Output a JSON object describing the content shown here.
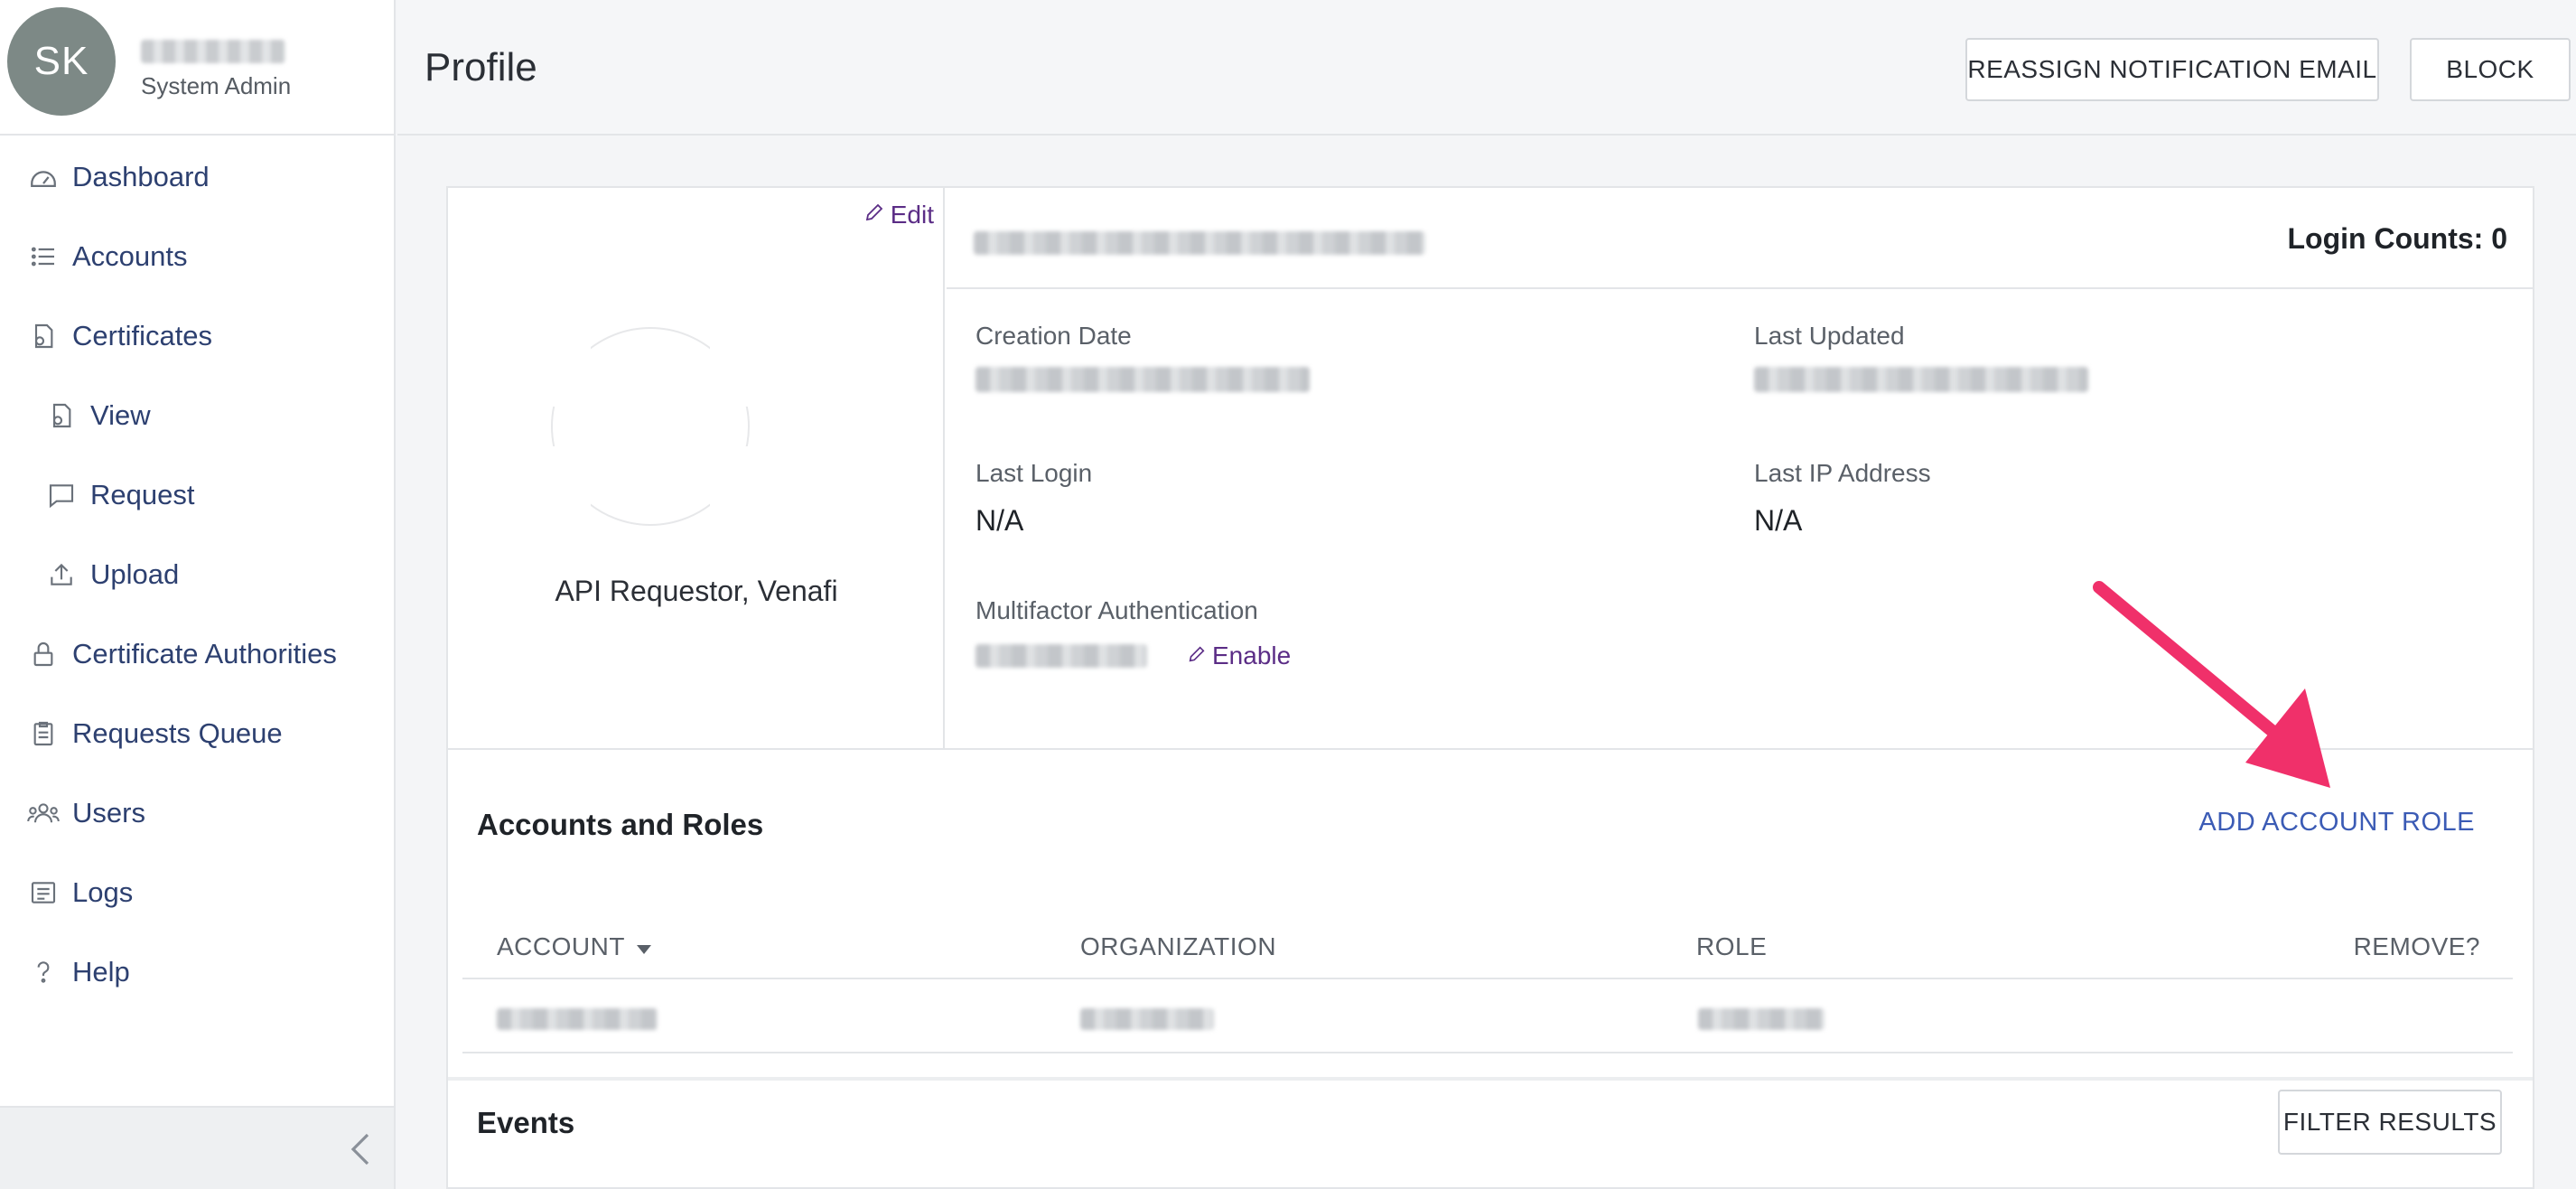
{
  "user": {
    "initials": "SK",
    "role": "System Admin"
  },
  "sidebar": {
    "items": [
      {
        "label": "Dashboard",
        "icon": "dashboard-icon"
      },
      {
        "label": "Accounts",
        "icon": "list-icon"
      },
      {
        "label": "Certificates",
        "icon": "certificates-icon"
      },
      {
        "label": "View",
        "icon": "view-certificate-icon"
      },
      {
        "label": "Request",
        "icon": "chat-bubble-icon"
      },
      {
        "label": "Upload",
        "icon": "upload-icon"
      },
      {
        "label": "Certificate Authorities",
        "icon": "lock-icon"
      },
      {
        "label": "Requests Queue",
        "icon": "clipboard-icon"
      },
      {
        "label": "Users",
        "icon": "users-icon"
      },
      {
        "label": "Logs",
        "icon": "logs-icon"
      },
      {
        "label": "Help",
        "icon": "help-icon"
      }
    ],
    "collapse_icon": "chevron-left-icon"
  },
  "header": {
    "title": "Profile",
    "reassign_label": "REASSIGN NOTIFICATION EMAIL",
    "block_label": "BLOCK"
  },
  "profile": {
    "edit_label": "Edit",
    "display_name": "API Requestor, Venafi",
    "login_counts": "Login Counts: 0",
    "creation_date_label": "Creation Date",
    "last_updated_label": "Last Updated",
    "last_login_label": "Last Login",
    "last_login_value": "N/A",
    "last_ip_label": "Last IP Address",
    "last_ip_value": "N/A",
    "mfa_label": "Multifactor Authentication",
    "enable_label": "Enable"
  },
  "accounts_roles": {
    "title": "Accounts and Roles",
    "add_label": "ADD ACCOUNT ROLE",
    "columns": [
      "ACCOUNT",
      "ORGANIZATION",
      "ROLE",
      "REMOVE?"
    ]
  },
  "events": {
    "title": "Events",
    "filter_label": "FILTER RESULTS"
  },
  "colors": {
    "accent_link": "#3b5bb5",
    "edit_link": "#5b2d86",
    "annotation_arrow": "#f0306a",
    "avatar_bg": "#7d8986"
  }
}
